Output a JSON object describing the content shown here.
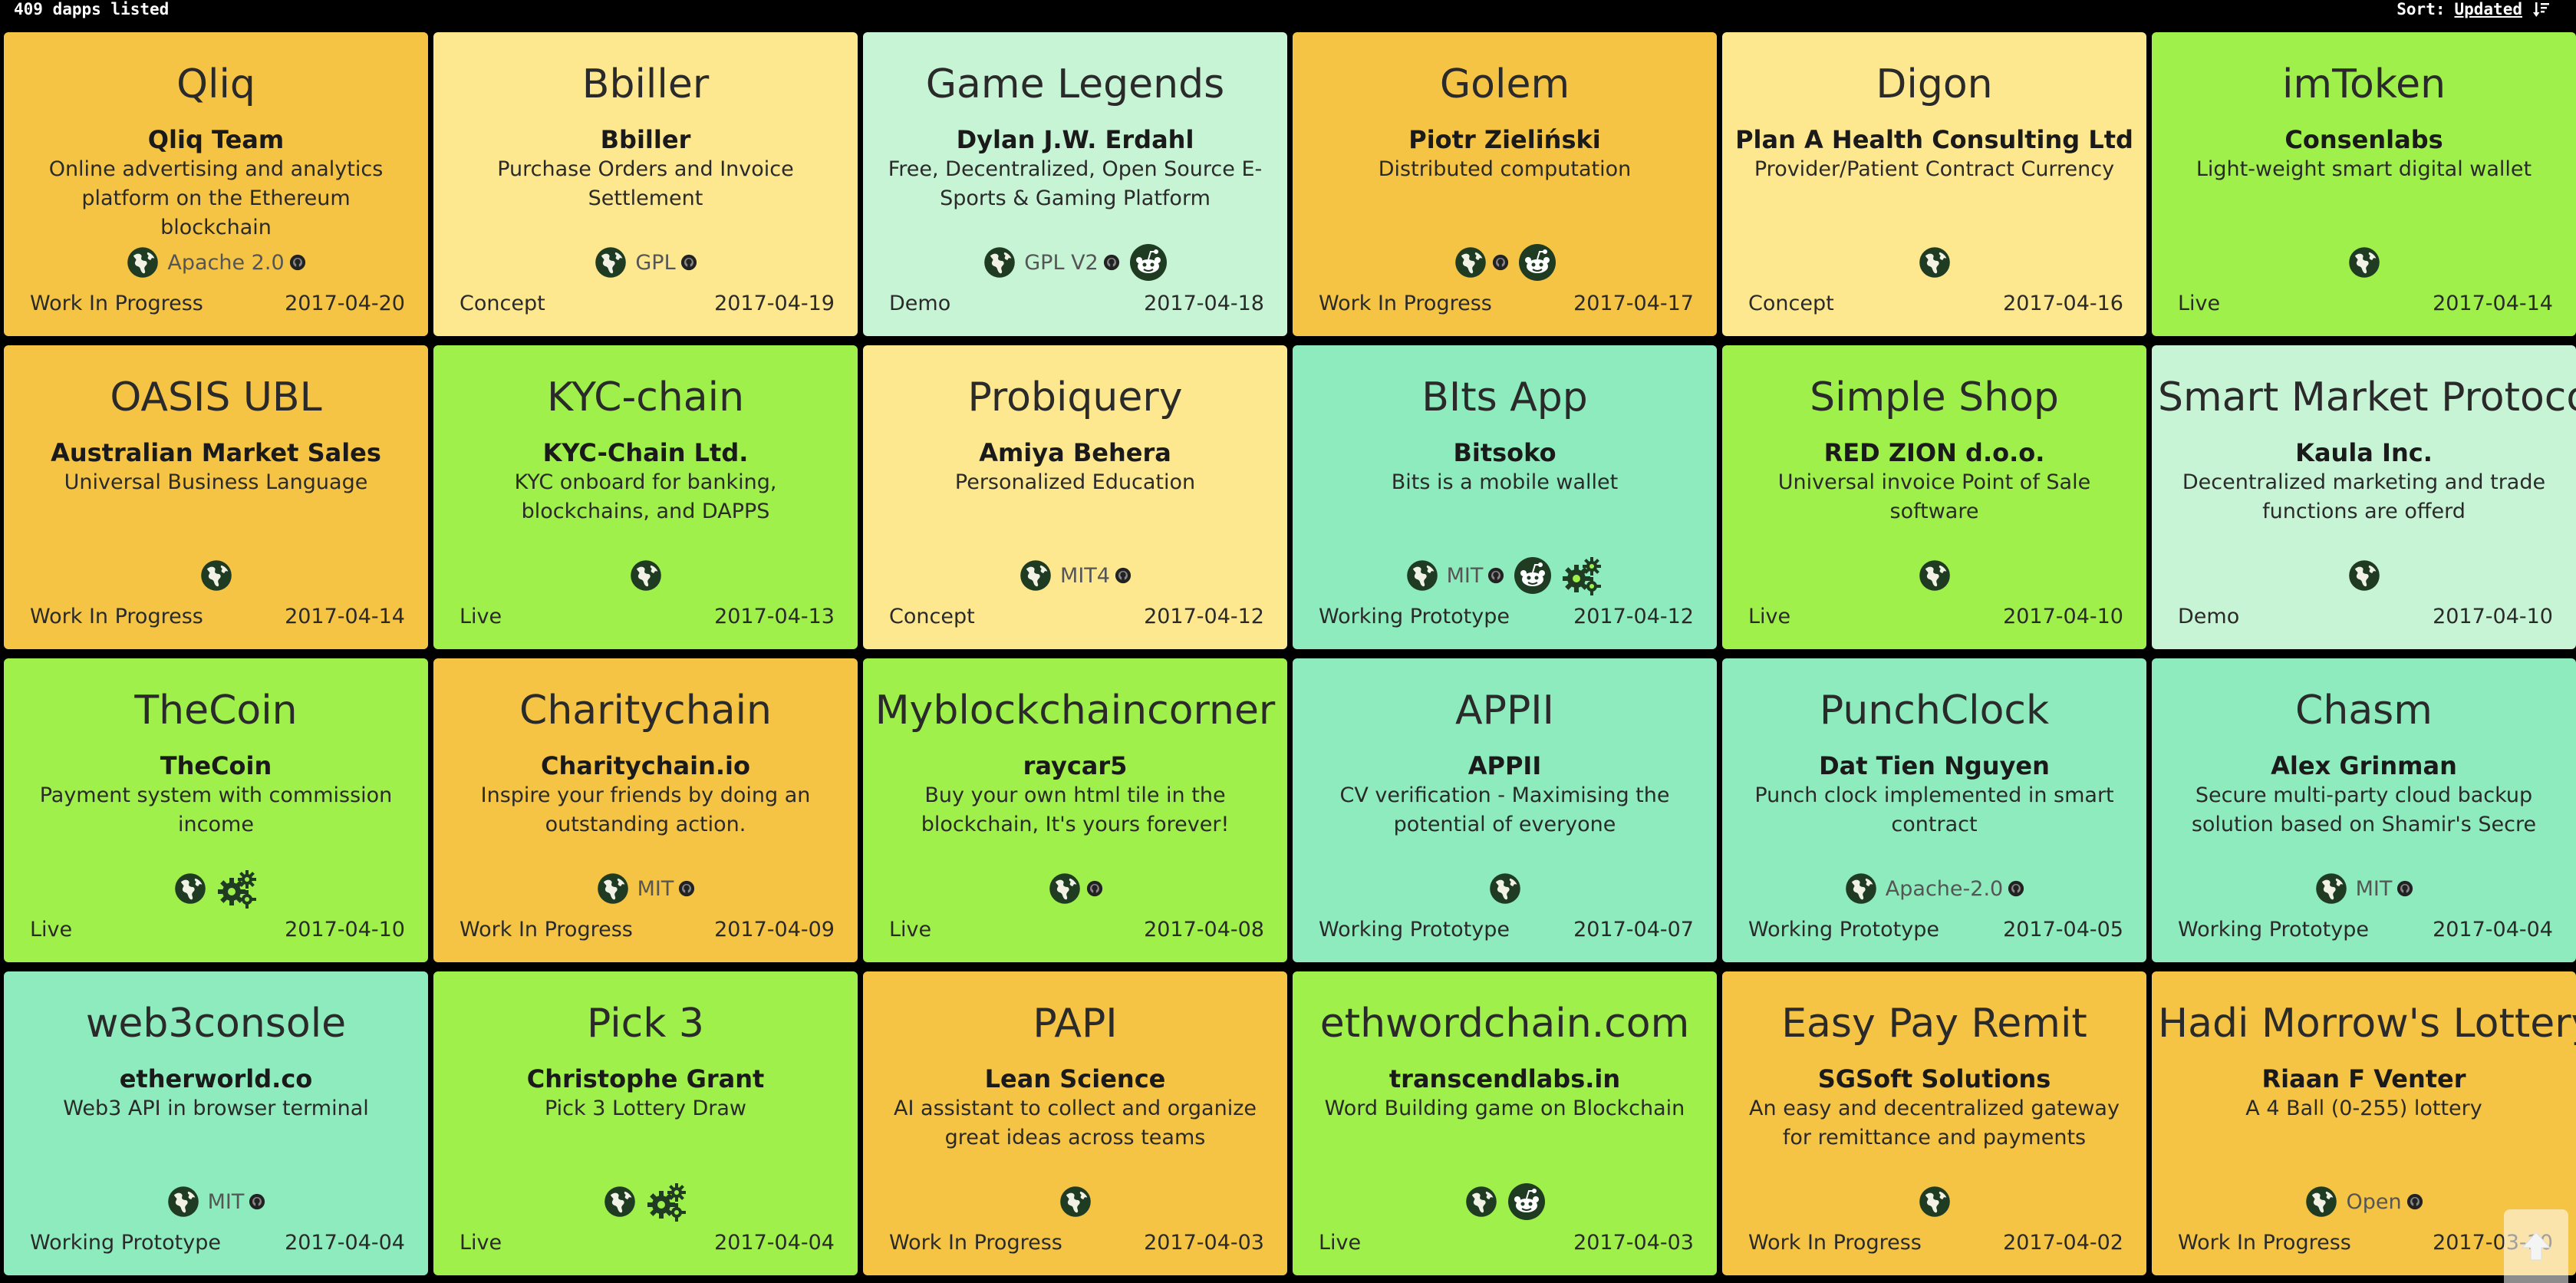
{
  "header": {
    "count_text": "409 dapps listed",
    "sort_label": "Sort:",
    "sort_value": "Updated"
  },
  "colors": {
    "Work In Progress": "#f6c445",
    "Concept": "#fde78f",
    "Demo": "#c8f4d6",
    "Live": "#9ff04a",
    "Working Prototype": "#8eebbd"
  },
  "cards": [
    {
      "name": "Qliq",
      "author": "Qliq Team",
      "desc": "Online advertising and analytics platform on the Ethereum blockchain",
      "status": "Work In Progress",
      "date": "2017-04-20",
      "license": "Apache 2.0",
      "icons": [
        "globe-icon",
        "github-icon"
      ]
    },
    {
      "name": "Bbiller",
      "author": "Bbiller",
      "desc": "Purchase Orders and Invoice Settlement",
      "status": "Concept",
      "date": "2017-04-19",
      "license": "GPL",
      "icons": [
        "globe-icon",
        "github-icon"
      ]
    },
    {
      "name": "Game Legends",
      "author": "Dylan J.W. Erdahl",
      "desc": "Free, Decentralized, Open Source E-Sports & Gaming Platform",
      "status": "Demo",
      "date": "2017-04-18",
      "license": "GPL V2",
      "icons": [
        "globe-icon",
        "github-icon",
        "reddit-icon"
      ]
    },
    {
      "name": "Golem",
      "author": "Piotr Zieliński",
      "desc": "Distributed computation",
      "status": "Work In Progress",
      "date": "2017-04-17",
      "license": "",
      "icons": [
        "globe-icon",
        "github-icon",
        "reddit-icon"
      ]
    },
    {
      "name": "Digon",
      "author": "Plan A Health Consulting Ltd",
      "desc": "Provider/Patient Contract Currency",
      "status": "Concept",
      "date": "2017-04-16",
      "license": "",
      "icons": [
        "globe-icon"
      ]
    },
    {
      "name": "imToken",
      "author": "Consenlabs",
      "desc": "Light-weight smart digital wallet",
      "status": "Live",
      "date": "2017-04-14",
      "license": "",
      "icons": [
        "globe-icon"
      ]
    },
    {
      "name": "OASIS UBL",
      "author": "Australian Market Sales",
      "desc": "Universal Business Language",
      "status": "Work In Progress",
      "date": "2017-04-14",
      "license": "",
      "icons": [
        "globe-icon"
      ]
    },
    {
      "name": "KYC-chain",
      "author": "KYC-Chain Ltd.",
      "desc": "KYC onboard for banking, blockchains, and DAPPS",
      "status": "Live",
      "date": "2017-04-13",
      "license": "",
      "icons": [
        "globe-icon"
      ]
    },
    {
      "name": "Probiquery",
      "author": "Amiya Behera",
      "desc": "Personalized Education",
      "status": "Concept",
      "date": "2017-04-12",
      "license": "MIT4",
      "icons": [
        "globe-icon",
        "github-icon"
      ]
    },
    {
      "name": "BIts App",
      "author": "Bitsoko",
      "desc": "Bits is a mobile wallet",
      "status": "Working Prototype",
      "date": "2017-04-12",
      "license": "MIT",
      "icons": [
        "globe-icon",
        "github-icon",
        "reddit-icon",
        "gears-icon"
      ]
    },
    {
      "name": "Simple Shop",
      "author": "RED ZION d.o.o.",
      "desc": "Universal invoice Point of Sale software",
      "status": "Live",
      "date": "2017-04-10",
      "license": "",
      "icons": [
        "globe-icon"
      ]
    },
    {
      "name": "Smart Market Protocol",
      "author": "Kaula Inc.",
      "desc": "Decentralized marketing and trade functions are offerd",
      "status": "Demo",
      "date": "2017-04-10",
      "license": "",
      "icons": [
        "globe-icon"
      ]
    },
    {
      "name": "TheCoin",
      "author": "TheCoin",
      "desc": "Payment system with commission income",
      "status": "Live",
      "date": "2017-04-10",
      "license": "",
      "icons": [
        "globe-icon",
        "gears-icon"
      ]
    },
    {
      "name": "Charitychain",
      "author": "Charitychain.io",
      "desc": "Inspire your friends by doing an outstanding action.",
      "status": "Work In Progress",
      "date": "2017-04-09",
      "license": "MIT",
      "icons": [
        "globe-icon",
        "github-icon"
      ]
    },
    {
      "name": "Myblockchaincorner",
      "author": "raycar5",
      "desc": "Buy your own html tile in the blockchain, It's yours forever!",
      "status": "Live",
      "date": "2017-04-08",
      "license": "",
      "icons": [
        "globe-icon",
        "github-icon"
      ]
    },
    {
      "name": "APPII",
      "author": "APPII",
      "desc": "CV verification - Maximising the potential of everyone",
      "status": "Working Prototype",
      "date": "2017-04-07",
      "license": "",
      "icons": [
        "globe-icon"
      ]
    },
    {
      "name": "PunchClock",
      "author": "Dat Tien Nguyen",
      "desc": "Punch clock implemented in smart contract",
      "status": "Working Prototype",
      "date": "2017-04-05",
      "license": "Apache-2.0",
      "icons": [
        "globe-icon",
        "github-icon"
      ]
    },
    {
      "name": "Chasm",
      "author": "Alex Grinman",
      "desc": "Secure multi-party cloud backup solution based on Shamir's Secre",
      "status": "Working Prototype",
      "date": "2017-04-04",
      "license": "MIT",
      "icons": [
        "globe-icon",
        "github-icon"
      ]
    },
    {
      "name": "web3console",
      "author": "etherworld.co",
      "desc": "Web3 API in browser terminal",
      "status": "Working Prototype",
      "date": "2017-04-04",
      "license": "MIT",
      "icons": [
        "globe-icon",
        "github-icon"
      ]
    },
    {
      "name": "Pick 3",
      "author": "Christophe Grant",
      "desc": "Pick 3 Lottery Draw",
      "status": "Live",
      "date": "2017-04-04",
      "license": "",
      "icons": [
        "globe-icon",
        "gears-icon"
      ]
    },
    {
      "name": "PAPI",
      "author": "Lean Science",
      "desc": "AI assistant to collect and organize great ideas across teams",
      "status": "Work In Progress",
      "date": "2017-04-03",
      "license": "",
      "icons": [
        "globe-icon"
      ]
    },
    {
      "name": "ethwordchain.com",
      "author": "transcendlabs.in",
      "desc": "Word Building game on Blockchain",
      "status": "Live",
      "date": "2017-04-03",
      "license": "",
      "icons": [
        "globe-icon",
        "reddit-icon"
      ]
    },
    {
      "name": "Easy Pay Remit",
      "author": "SGSoft Solutions",
      "desc": "An easy and decentralized gateway for remittance and payments",
      "status": "Work In Progress",
      "date": "2017-04-02",
      "license": "",
      "icons": [
        "globe-icon"
      ]
    },
    {
      "name": "Hadi Morrow's Lottery",
      "author": "Riaan F Venter",
      "desc": "A 4 Ball (0-255) lottery",
      "status": "Work In Progress",
      "date": "2017-03-10",
      "license": "Open",
      "icons": [
        "globe-icon",
        "github-icon"
      ]
    }
  ]
}
